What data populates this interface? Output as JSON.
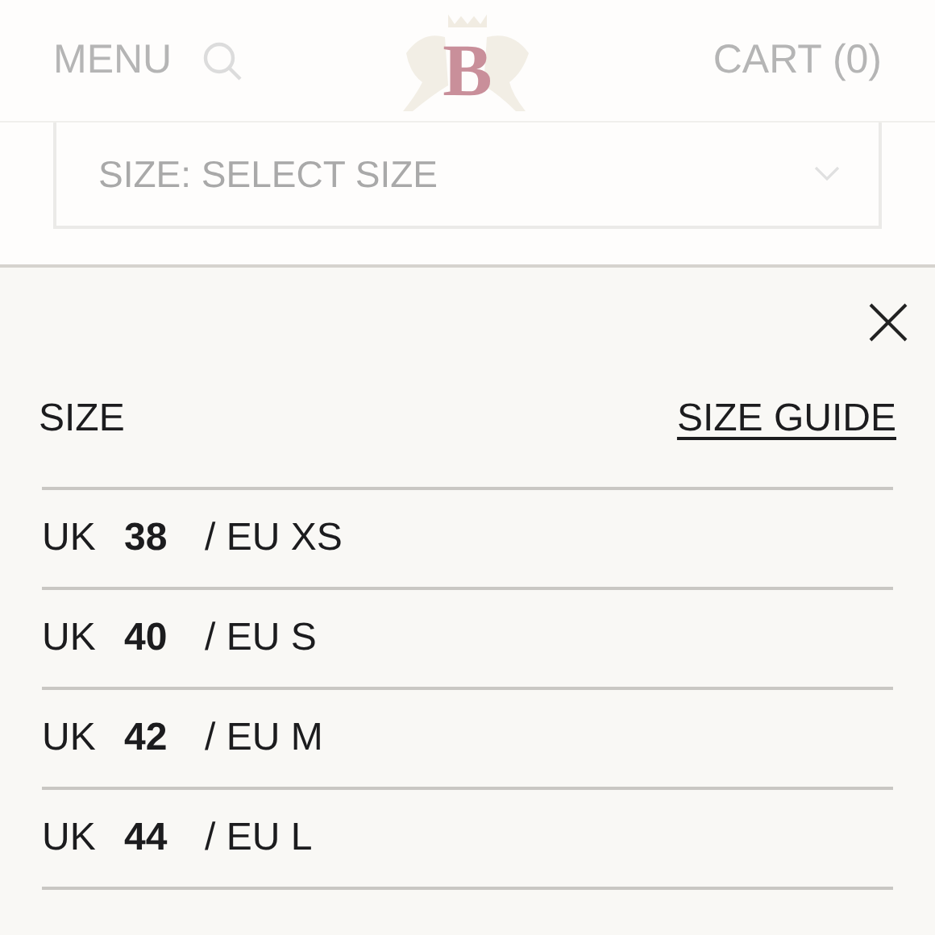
{
  "header": {
    "menu": "MENU",
    "logo_letter": "B",
    "cart": "CART (0)"
  },
  "size_select": {
    "label": "SIZE: SELECT SIZE"
  },
  "size_panel": {
    "title": "SIZE",
    "guide_link": "SIZE GUIDE",
    "options": [
      {
        "uk": "UK",
        "size": "38",
        "eu": "/ EU XS"
      },
      {
        "uk": "UK",
        "size": "40",
        "eu": "/ EU S"
      },
      {
        "uk": "UK",
        "size": "42",
        "eu": "/ EU M"
      },
      {
        "uk": "UK",
        "size": "44",
        "eu": "/ EU L"
      }
    ]
  }
}
